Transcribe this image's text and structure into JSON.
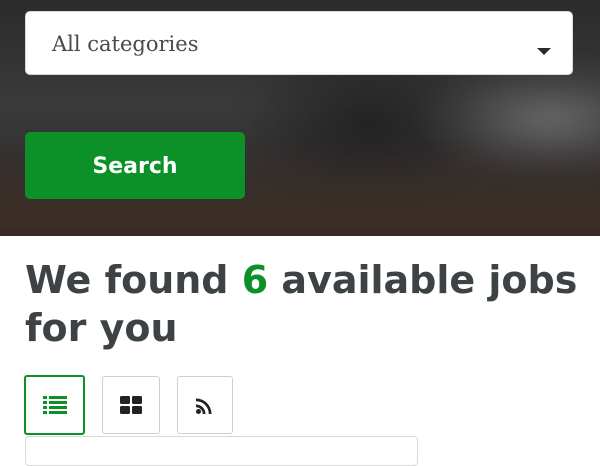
{
  "search_form": {
    "category_select": {
      "value": "All categories"
    },
    "search_label": "Search"
  },
  "results": {
    "heading_prefix": "We found ",
    "count": "6",
    "heading_suffix": " available jobs for you"
  },
  "view_options": {
    "active": "list",
    "items": [
      {
        "id": "list",
        "icon": "list-icon"
      },
      {
        "id": "grid",
        "icon": "grid-icon"
      },
      {
        "id": "rss",
        "icon": "rss-icon"
      }
    ]
  },
  "colors": {
    "accent": "#0b9128",
    "heading": "#3d4245"
  }
}
